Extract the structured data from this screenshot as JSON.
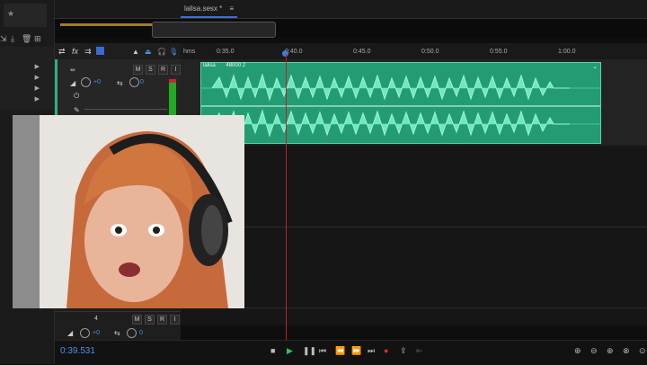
{
  "tab": {
    "file": "lalisa.sesx *"
  },
  "ruler": {
    "unit": "hms",
    "ticks": [
      "0:35.0",
      "0:40.0",
      "0:45.0",
      "0:50.0",
      "0:55.0",
      "1:00.0"
    ]
  },
  "track1": {
    "mute": "M",
    "solo": "S",
    "rec": "R",
    "volume": "+0",
    "pan": "0"
  },
  "clip": {
    "name": "lalisa",
    "info": "48000 2"
  },
  "track2": {
    "number": "4",
    "mute": "M",
    "solo": "S",
    "rec": "R",
    "volume": "+0",
    "pan": "0"
  },
  "transport": {
    "timecode": "0:39.531"
  }
}
